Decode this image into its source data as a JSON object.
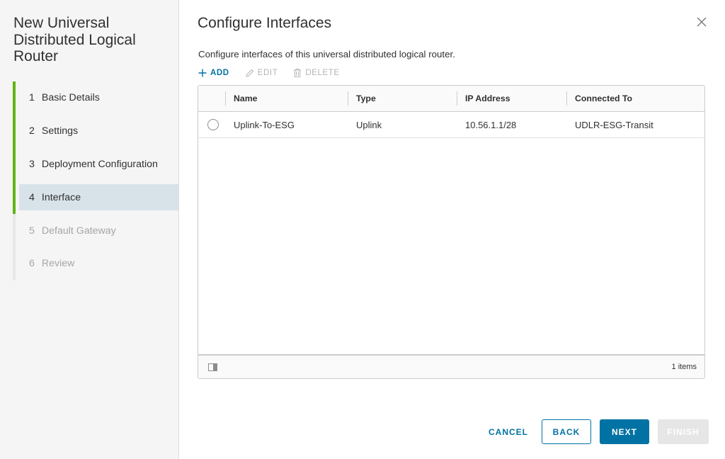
{
  "wizard": {
    "title": "New Universal Distributed Logical Router",
    "steps": [
      {
        "num": "1",
        "label": "Basic Details",
        "state": "done"
      },
      {
        "num": "2",
        "label": "Settings",
        "state": "done"
      },
      {
        "num": "3",
        "label": "Deployment Configuration",
        "state": "done"
      },
      {
        "num": "4",
        "label": "Interface",
        "state": "current"
      },
      {
        "num": "5",
        "label": "Default Gateway",
        "state": "future"
      },
      {
        "num": "6",
        "label": "Review",
        "state": "future"
      }
    ]
  },
  "page": {
    "title": "Configure Interfaces",
    "description": "Configure interfaces of this universal distributed logical router."
  },
  "toolbar": {
    "add_label": "ADD",
    "edit_label": "EDIT",
    "delete_label": "DELETE"
  },
  "grid": {
    "columns": [
      "Name",
      "Type",
      "IP Address",
      "Connected To"
    ],
    "rows": [
      {
        "name": "Uplink-To-ESG",
        "type": "Uplink",
        "ip": "10.56.1.1/28",
        "connected_to": "UDLR-ESG-Transit"
      }
    ],
    "footer_count": "1 items"
  },
  "buttons": {
    "cancel": "CANCEL",
    "back": "BACK",
    "next": "NEXT",
    "finish": "FINISH"
  },
  "colors": {
    "accent": "#0072a3",
    "step_done": "#60b515",
    "step_current_bg": "#d8e3e9",
    "disabled": "#b3b3b3"
  },
  "icons": {
    "close": "close-icon",
    "add": "plus-icon",
    "edit": "pencil-icon",
    "delete": "trash-icon",
    "column_toggle": "column-toggle-icon"
  }
}
